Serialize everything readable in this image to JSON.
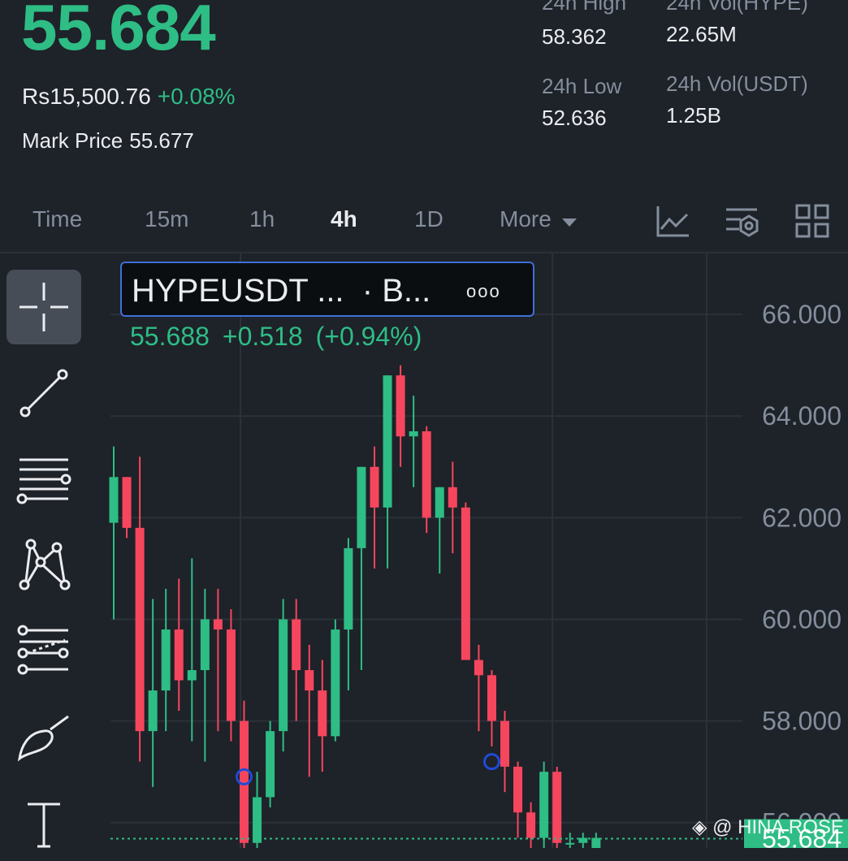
{
  "ticker": {
    "last_price": "55.684",
    "fiat_price": "Rs15,500.76",
    "change_pct": "+0.08%",
    "mark_price_label": "Mark Price",
    "mark_price": "55.677"
  },
  "stats": {
    "high_label": "24h High",
    "high_value": "58.362",
    "vol_base_label": "24h Vol(HYPE)",
    "vol_base_value": "22.65M",
    "low_label": "24h Low",
    "low_value": "52.636",
    "vol_quote_label": "24h Vol(USDT)",
    "vol_quote_value": "1.25B"
  },
  "tabs": {
    "time": "Time",
    "m15": "15m",
    "h1": "1h",
    "h4": "4h",
    "d1": "1D",
    "more": "More",
    "active": "4h"
  },
  "tool_icons": [
    "crosshair-icon",
    "trend-line-icon",
    "horizontal-lines-icon",
    "pattern-icon",
    "fib-retracement-icon",
    "brush-icon",
    "text-icon"
  ],
  "legend": {
    "symbol": "HYPEUSDT ...",
    "source": "· B...",
    "more": "ooo",
    "last": "55.688",
    "change": "+0.518",
    "change_pct": "(+0.94%)"
  },
  "colors": {
    "up": "#2ebd85",
    "down": "#f6465d",
    "background": "#1e2229",
    "marker": "#1e4bd8"
  },
  "chart_data": {
    "type": "candlestick",
    "ylim": [
      55.5,
      67.2
    ],
    "y_ticks": [
      "66.000",
      "64.000",
      "62.000",
      "60.000",
      "58.000",
      "56.000"
    ],
    "candles": [
      {
        "o": 61.9,
        "h": 63.4,
        "l": 60.0,
        "c": 62.8
      },
      {
        "o": 62.8,
        "h": 62.8,
        "l": 61.6,
        "c": 61.8
      },
      {
        "o": 61.8,
        "h": 63.2,
        "l": 57.2,
        "c": 57.8
      },
      {
        "o": 57.8,
        "h": 60.4,
        "l": 56.7,
        "c": 58.6
      },
      {
        "o": 58.6,
        "h": 60.6,
        "l": 57.8,
        "c": 59.8
      },
      {
        "o": 59.8,
        "h": 60.8,
        "l": 58.2,
        "c": 58.8
      },
      {
        "o": 58.8,
        "h": 61.2,
        "l": 57.6,
        "c": 59.0
      },
      {
        "o": 59.0,
        "h": 60.6,
        "l": 57.2,
        "c": 60.0
      },
      {
        "o": 60.0,
        "h": 60.6,
        "l": 57.8,
        "c": 59.8
      },
      {
        "o": 59.8,
        "h": 60.2,
        "l": 57.6,
        "c": 58.0
      },
      {
        "o": 58.0,
        "h": 58.4,
        "l": 55.5,
        "c": 55.6
      },
      {
        "o": 55.6,
        "h": 57.0,
        "l": 55.5,
        "c": 56.5
      },
      {
        "o": 56.5,
        "h": 58.0,
        "l": 56.3,
        "c": 57.8
      },
      {
        "o": 57.8,
        "h": 60.4,
        "l": 57.4,
        "c": 60.0
      },
      {
        "o": 60.0,
        "h": 60.4,
        "l": 58.0,
        "c": 59.0
      },
      {
        "o": 59.0,
        "h": 59.5,
        "l": 56.9,
        "c": 58.6
      },
      {
        "o": 58.6,
        "h": 59.2,
        "l": 57.0,
        "c": 57.7
      },
      {
        "o": 57.7,
        "h": 60.0,
        "l": 57.6,
        "c": 59.8
      },
      {
        "o": 59.8,
        "h": 61.6,
        "l": 58.6,
        "c": 61.4
      },
      {
        "o": 61.4,
        "h": 63.0,
        "l": 59.0,
        "c": 63.0
      },
      {
        "o": 63.0,
        "h": 63.4,
        "l": 61.0,
        "c": 62.2
      },
      {
        "o": 62.2,
        "h": 64.8,
        "l": 61.0,
        "c": 64.8
      },
      {
        "o": 64.8,
        "h": 65.0,
        "l": 63.0,
        "c": 63.6
      },
      {
        "o": 63.6,
        "h": 64.4,
        "l": 62.6,
        "c": 63.7
      },
      {
        "o": 63.7,
        "h": 63.8,
        "l": 61.7,
        "c": 62.0
      },
      {
        "o": 62.0,
        "h": 62.6,
        "l": 60.9,
        "c": 62.6
      },
      {
        "o": 62.6,
        "h": 63.1,
        "l": 61.3,
        "c": 62.2
      },
      {
        "o": 62.2,
        "h": 62.3,
        "l": 59.6,
        "c": 59.2
      },
      {
        "o": 59.2,
        "h": 59.5,
        "l": 57.8,
        "c": 58.9
      },
      {
        "o": 58.9,
        "h": 59.0,
        "l": 57.5,
        "c": 58.0
      },
      {
        "o": 58.0,
        "h": 58.2,
        "l": 56.6,
        "c": 57.1
      },
      {
        "o": 57.1,
        "h": 57.2,
        "l": 55.7,
        "c": 56.2
      },
      {
        "o": 56.2,
        "h": 56.4,
        "l": 55.5,
        "c": 55.7
      },
      {
        "o": 55.7,
        "h": 57.2,
        "l": 55.5,
        "c": 57.0
      },
      {
        "o": 57.0,
        "h": 57.1,
        "l": 55.5,
        "c": 55.6
      },
      {
        "o": 55.6,
        "h": 55.8,
        "l": 55.5,
        "c": 55.6
      },
      {
        "o": 55.6,
        "h": 55.8,
        "l": 55.5,
        "c": 55.7
      },
      {
        "o": 55.5,
        "h": 55.8,
        "l": 55.5,
        "c": 55.7
      }
    ],
    "markers": [
      {
        "candle": 10,
        "price": 56.9
      },
      {
        "candle": 29,
        "price": 57.2
      }
    ],
    "current_price_line": 55.684,
    "current_price_label": "55.684"
  },
  "watermark": "@ HINA ROSE"
}
